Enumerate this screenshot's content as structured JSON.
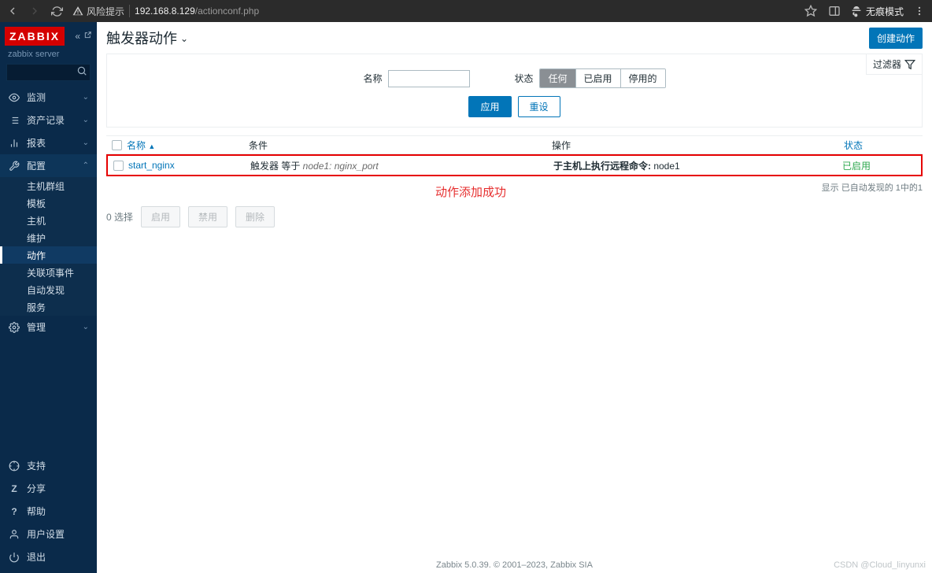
{
  "browser": {
    "warn": "风险提示",
    "url_host": "192.168.8.129",
    "url_path": "/actionconf.php",
    "incognito": "无痕模式"
  },
  "sidebar": {
    "logo": "ZABBIX",
    "server": "zabbix server",
    "items": [
      {
        "label": "监测",
        "icon": "eye"
      },
      {
        "label": "资产记录",
        "icon": "list"
      },
      {
        "label": "报表",
        "icon": "chart"
      },
      {
        "label": "配置",
        "icon": "wrench",
        "active": true
      },
      {
        "label": "管理",
        "icon": "gear"
      }
    ],
    "config_sub": [
      {
        "label": "主机群组"
      },
      {
        "label": "模板"
      },
      {
        "label": "主机"
      },
      {
        "label": "维护"
      },
      {
        "label": "动作",
        "active": true
      },
      {
        "label": "关联项事件"
      },
      {
        "label": "自动发现"
      },
      {
        "label": "服务"
      }
    ],
    "bottom": [
      {
        "label": "支持",
        "icon": "support"
      },
      {
        "label": "分享",
        "icon": "share"
      },
      {
        "label": "帮助",
        "icon": "help"
      },
      {
        "label": "用户设置",
        "icon": "user"
      },
      {
        "label": "退出",
        "icon": "power"
      }
    ]
  },
  "header": {
    "title": "触发器动作",
    "create_btn": "创建动作"
  },
  "filter": {
    "tab": "过滤器",
    "name_label": "名称",
    "name_value": "",
    "status_label": "状态",
    "seg": [
      "任何",
      "已启用",
      "停用的"
    ],
    "apply": "应用",
    "reset": "重设"
  },
  "table": {
    "headers": {
      "name": "名称",
      "cond": "条件",
      "op": "操作",
      "status": "状态"
    },
    "rows": [
      {
        "name": "start_nginx",
        "cond_prefix": "触发器 等于 ",
        "cond_italic": "node1: nginx_port",
        "op_prefix_bold": "于主机上执行远程命令:",
        "op_suffix": " node1",
        "status": "已启用"
      }
    ],
    "count_text": "显示 已自动发现的 1中的1"
  },
  "bulk": {
    "sel": "0 选择",
    "enable": "启用",
    "disable": "禁用",
    "delete": "删除"
  },
  "annotation": "动作添加成功",
  "footer": "Zabbix 5.0.39. © 2001–2023, Zabbix SIA",
  "watermark": "CSDN @Cloud_linyunxi"
}
